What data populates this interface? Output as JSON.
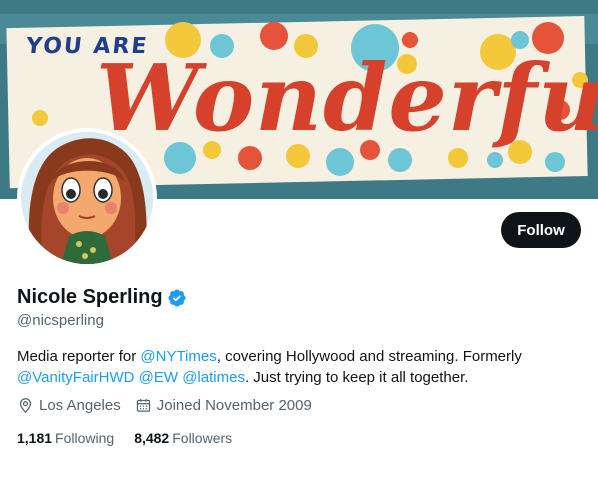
{
  "banner": {
    "text_top": "YOU ARE",
    "text_main": "Wonderful"
  },
  "profile": {
    "display_name": "Nicole Sperling",
    "handle": "@nicsperling",
    "verified": true
  },
  "follow_button": {
    "label": "Follow"
  },
  "bio": {
    "text_1": "Media reporter for ",
    "mention_1": "@NYTimes",
    "text_2": ", covering Hollywood and streaming. Formerly ",
    "mention_2": "@VanityFairHWD",
    "text_3": " ",
    "mention_3": "@EW",
    "text_4": " ",
    "mention_4": "@latimes",
    "text_5": ". Just trying to keep it all together."
  },
  "meta": {
    "location": "Los Angeles",
    "joined": "Joined November 2009",
    "location_icon": "location-pin-icon",
    "joined_icon": "calendar-icon"
  },
  "stats": {
    "following_count": "1,181",
    "following_label": "Following",
    "followers_count": "8,482",
    "followers_label": "Followers"
  },
  "colors": {
    "accent": "#1d9bf0",
    "button": "#0f1419",
    "muted_text": "#536471"
  }
}
